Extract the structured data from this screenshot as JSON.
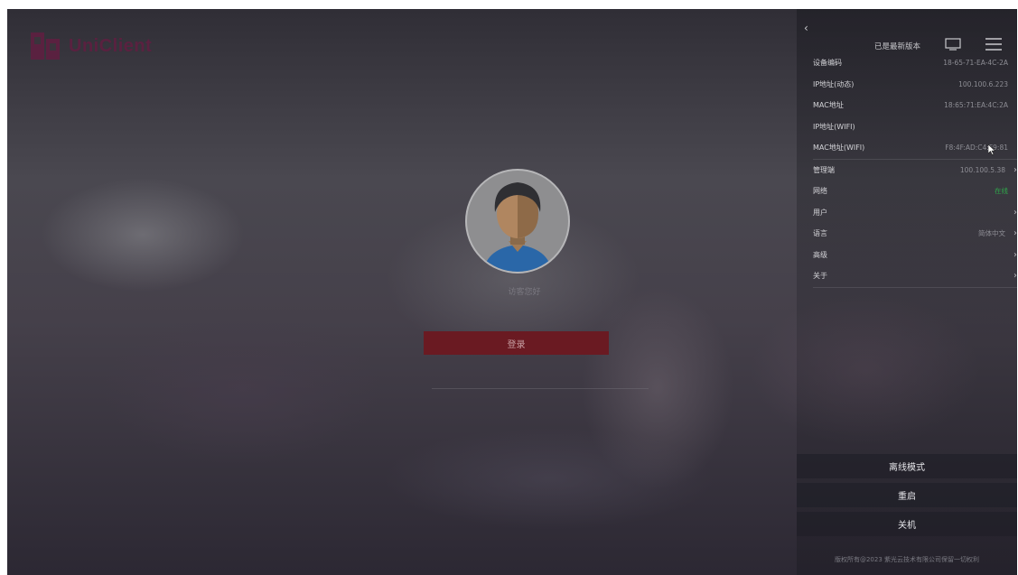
{
  "logo": {
    "text": "UniClient"
  },
  "login": {
    "greeting": "访客您好",
    "login_button": "登录"
  },
  "panel": {
    "version_status": "已是最新版本",
    "info_rows": [
      {
        "label": "设备编码",
        "value": "18-65-71-EA-4C-2A"
      },
      {
        "label": "IP地址(动态)",
        "value": "100.100.6.223"
      },
      {
        "label": "MAC地址",
        "value": "18:65:71:EA:4C:2A"
      },
      {
        "label": "IP地址(WIFI)",
        "value": ""
      },
      {
        "label": "MAC地址(WIFI)",
        "value": "F8:4F:AD:C4:F9:81"
      }
    ],
    "settings_rows": [
      {
        "label": "管理端",
        "value": "100.100.5.38"
      },
      {
        "label": "网络",
        "value": "在线",
        "status_color": "#2fa84a"
      },
      {
        "label": "用户",
        "value": ""
      },
      {
        "label": "语言",
        "value": "简体中文"
      },
      {
        "label": "高级",
        "value": ""
      },
      {
        "label": "关于",
        "value": ""
      }
    ],
    "actions": {
      "offline_mode": "离线模式",
      "restart": "重启",
      "shutdown": "关机"
    },
    "copyright": "版权所有@2023 紫光云技术有限公司保留一切权利"
  },
  "colors": {
    "accent": "#6a1a22",
    "brand": "#5a2140",
    "online": "#2fa84a"
  },
  "icons": [
    "back-chevron-icon",
    "monitor-icon",
    "menu-icon",
    "chevron-right-icon",
    "avatar-icon",
    "logo-icon",
    "mouse-cursor-icon"
  ]
}
